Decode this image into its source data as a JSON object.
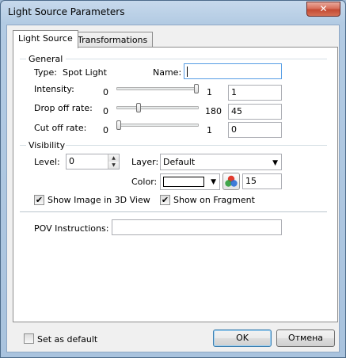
{
  "window": {
    "title": "Light Source Parameters",
    "close_glyph": "✕"
  },
  "tabs": [
    {
      "label": "Light Source"
    },
    {
      "label": "Transformations"
    }
  ],
  "general": {
    "title": "General",
    "type_label": "Type:",
    "type_value": "Spot Light",
    "name_label": "Name:",
    "name_value": "",
    "intensity": {
      "label": "Intensity:",
      "min": "0",
      "max": "1",
      "value": "1",
      "level": 1.0
    },
    "drop_off": {
      "label": "Drop off rate:",
      "min": "0",
      "max": "180",
      "value": "45",
      "level": 0.25
    },
    "cut_off": {
      "label": "Cut off rate:",
      "min": "0",
      "max": "1",
      "value": "0",
      "level": 0.0
    }
  },
  "visibility": {
    "title": "Visibility",
    "level_label": "Level:",
    "level_value": "0",
    "layer_label": "Layer:",
    "layer_value": "Default",
    "color_label": "Color:",
    "color_swatch": "#ffffff",
    "color_number": "15",
    "show_image_3d": {
      "label": "Show Image in 3D View",
      "checked": true
    },
    "show_on_fragment": {
      "label": "Show on Fragment",
      "checked": true
    }
  },
  "pov": {
    "label": "POV Instructions:",
    "value": ""
  },
  "footer": {
    "set_default": {
      "label": "Set as default",
      "checked": false
    },
    "ok_label": "OK",
    "cancel_label": "Отмена"
  },
  "icons": {
    "check_glyph": "✔",
    "dropdown_glyph": "▼",
    "spin_up": "▲",
    "spin_down": "▼"
  }
}
